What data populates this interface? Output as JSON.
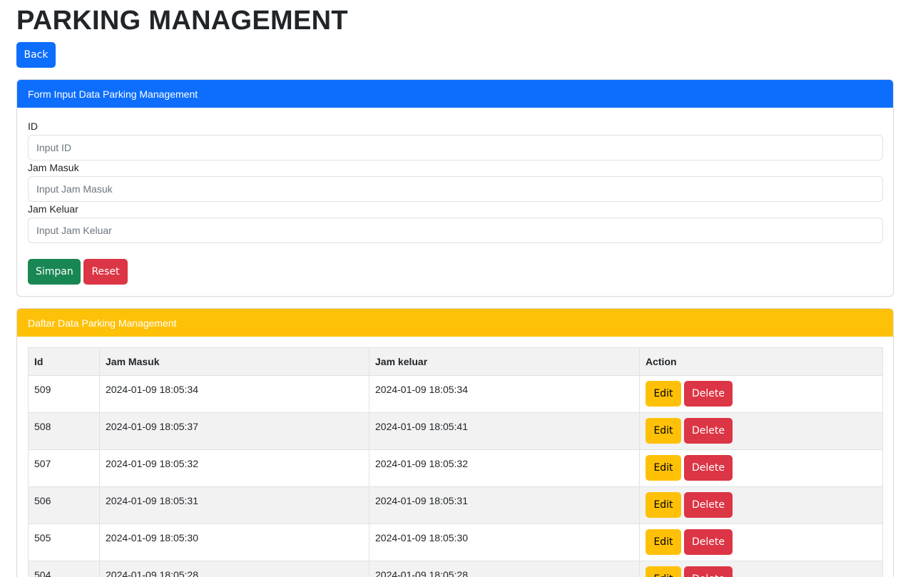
{
  "page": {
    "title": "PARKING MANAGEMENT",
    "back_label": "Back"
  },
  "form": {
    "header": "Form Input Data Parking Management",
    "fields": [
      {
        "label": "ID",
        "placeholder": "Input ID",
        "value": ""
      },
      {
        "label": "Jam Masuk",
        "placeholder": "Input Jam Masuk",
        "value": ""
      },
      {
        "label": "Jam Keluar",
        "placeholder": "Input Jam Keluar",
        "value": ""
      }
    ],
    "save_label": "Simpan",
    "reset_label": "Reset"
  },
  "list": {
    "header": "Daftar Data Parking Management",
    "columns": [
      "Id",
      "Jam Masuk",
      "Jam keluar",
      "Action"
    ],
    "edit_label": "Edit",
    "delete_label": "Delete",
    "rows": [
      {
        "id": "509",
        "masuk": "2024-01-09 18:05:34",
        "keluar": "2024-01-09 18:05:34"
      },
      {
        "id": "508",
        "masuk": "2024-01-09 18:05:37",
        "keluar": "2024-01-09 18:05:41"
      },
      {
        "id": "507",
        "masuk": "2024-01-09 18:05:32",
        "keluar": "2024-01-09 18:05:32"
      },
      {
        "id": "506",
        "masuk": "2024-01-09 18:05:31",
        "keluar": "2024-01-09 18:05:31"
      },
      {
        "id": "505",
        "masuk": "2024-01-09 18:05:30",
        "keluar": "2024-01-09 18:05:30"
      },
      {
        "id": "504",
        "masuk": "2024-01-09 18:05:28",
        "keluar": "2024-01-09 18:05:28"
      }
    ]
  },
  "colors": {
    "primary": "#0d6efd",
    "success": "#198754",
    "danger": "#dc3545",
    "warning": "#ffc107"
  }
}
